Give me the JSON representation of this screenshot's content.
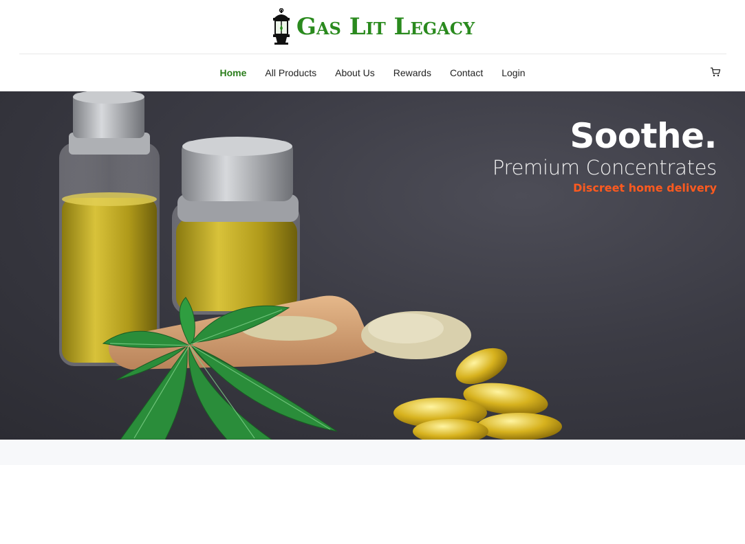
{
  "brand": {
    "name": "Gas Lit Legacy",
    "logo_icon": "lantern-icon",
    "logo_color": "#2a8a1e"
  },
  "nav": {
    "items": [
      {
        "label": "Home",
        "active": true
      },
      {
        "label": "All Products",
        "active": false
      },
      {
        "label": "About Us",
        "active": false
      },
      {
        "label": "Rewards",
        "active": false
      },
      {
        "label": "Contact",
        "active": false
      },
      {
        "label": "Login",
        "active": false
      }
    ],
    "cart_icon": "cart-icon",
    "active_color": "#2a7d1b"
  },
  "hero": {
    "title": "Soothe.",
    "subtitle": "Premium Concentrates",
    "tagline": "Discreet home delivery",
    "tagline_color": "#ff5a1f",
    "image": "cbd-oil-bottles-hemp-leaf-capsules"
  }
}
